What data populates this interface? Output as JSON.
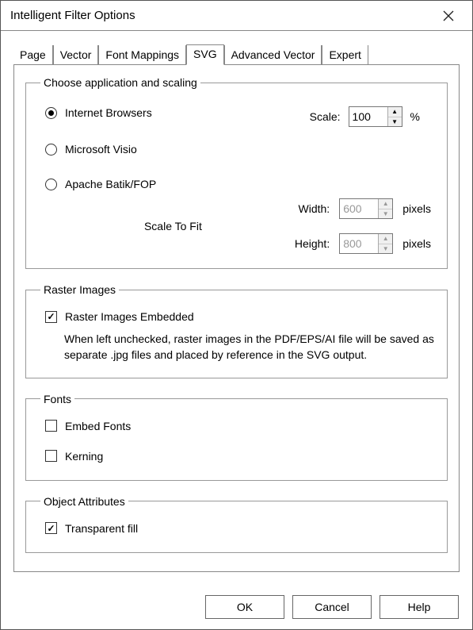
{
  "window": {
    "title": "Intelligent Filter Options"
  },
  "tabs": {
    "page": "Page",
    "vector": "Vector",
    "font_mappings": "Font Mappings",
    "svg": "SVG",
    "advanced_vector": "Advanced Vector",
    "expert": "Expert"
  },
  "group_scaling": {
    "legend": "Choose application and scaling",
    "radio_browsers": "Internet Browsers",
    "radio_visio": "Microsoft Visio",
    "radio_batik": "Apache Batik/FOP",
    "scale_label": "Scale:",
    "scale_value": "100",
    "scale_unit": "%",
    "scale_to_fit": "Scale To Fit",
    "width_label": "Width:",
    "width_value": "600",
    "height_label": "Height:",
    "height_value": "800",
    "pixels": "pixels"
  },
  "group_raster": {
    "legend": "Raster Images",
    "embedded": "Raster Images Embedded",
    "desc": "When left unchecked, raster images in the PDF/EPS/AI file will be saved as separate .jpg files and placed by reference in the SVG output."
  },
  "group_fonts": {
    "legend": "Fonts",
    "embed": "Embed Fonts",
    "kerning": "Kerning"
  },
  "group_attrs": {
    "legend": "Object Attributes",
    "transparent": "Transparent fill"
  },
  "buttons": {
    "ok": "OK",
    "cancel": "Cancel",
    "help": "Help"
  }
}
